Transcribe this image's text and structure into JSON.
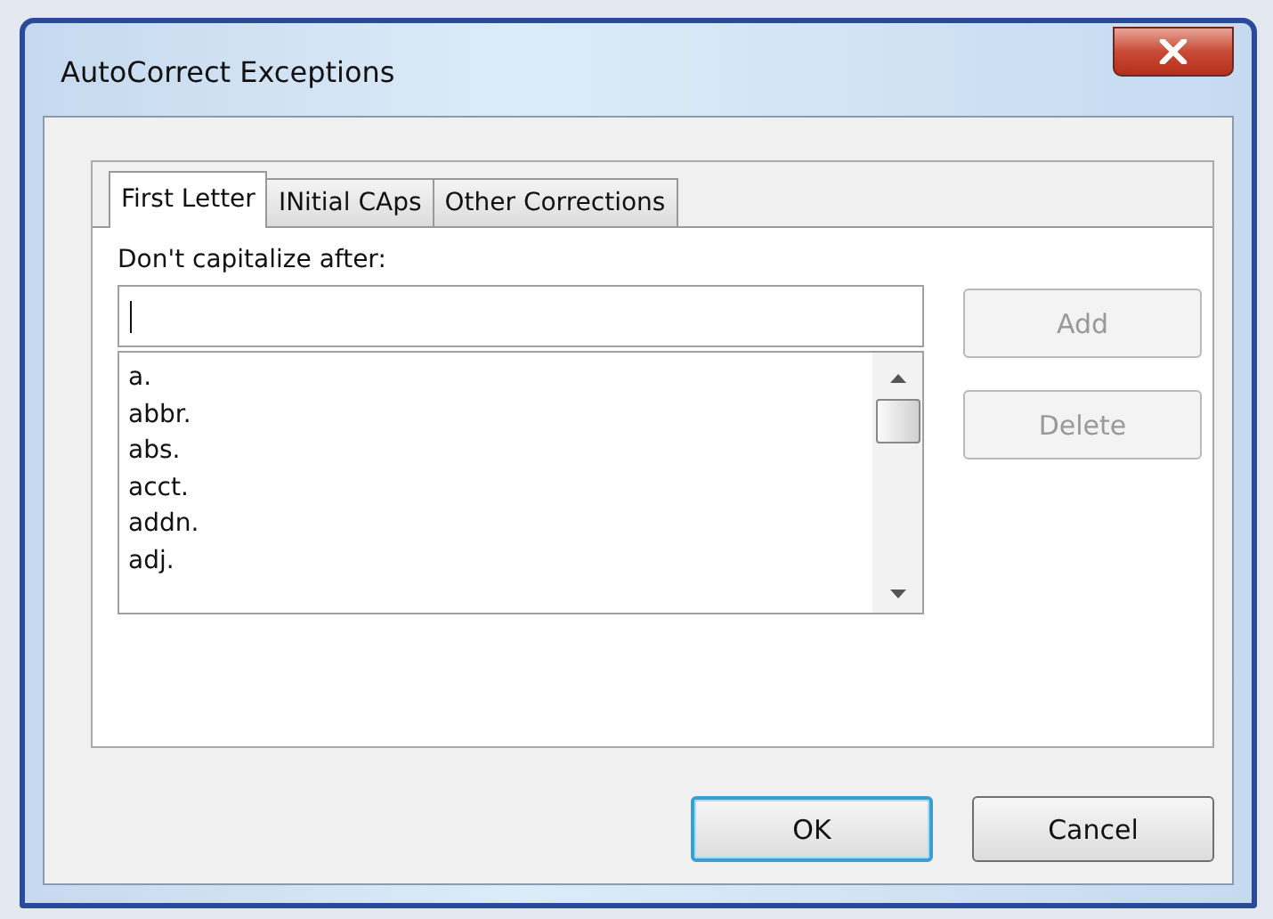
{
  "window": {
    "title": "AutoCorrect Exceptions"
  },
  "tabs": [
    {
      "label": "First Letter",
      "selected": true
    },
    {
      "label": "INitial CAps",
      "selected": false
    },
    {
      "label": "Other Corrections",
      "selected": false
    }
  ],
  "field": {
    "label": "Don't capitalize after:"
  },
  "list": {
    "items": [
      "a.",
      "abbr.",
      "abs.",
      "acct.",
      "addn.",
      "adj."
    ]
  },
  "side_buttons": [
    {
      "label": "Add",
      "disabled": true
    },
    {
      "label": "Delete",
      "disabled": true
    }
  ],
  "buttons": [
    {
      "label": "OK",
      "focused": true
    },
    {
      "label": "Cancel",
      "focused": false
    }
  ]
}
